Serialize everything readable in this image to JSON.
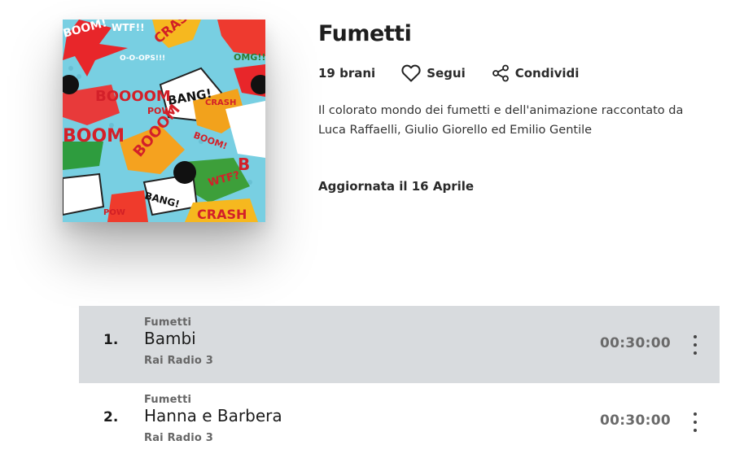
{
  "playlist": {
    "title": "Fumetti",
    "tracks_count": "19 brani",
    "follow_label": "Segui",
    "share_label": "Condividi",
    "description": "Il colorato mondo dei fumetti e dell'animazione raccontato da Luca Raffaelli, Giulio Giorello ed Emilio Gentile",
    "updated": "Aggiornata il 16 Aprile",
    "cover_words": [
      "BOOM!",
      "WTF!!",
      "CRASH",
      "O-O-OPS!!!",
      "OMG!!!",
      "BANG!",
      "BOOOOM",
      "POW",
      "CRASH",
      "BOOM!",
      "BOOOM",
      "WTF?",
      "BANG!",
      "POW",
      "CRASH"
    ]
  },
  "tracks": [
    {
      "number": "1.",
      "program": "Fumetti",
      "title": "Bambi",
      "channel": "Rai Radio 3",
      "duration": "00:30:00",
      "active": true
    },
    {
      "number": "2.",
      "program": "Fumetti",
      "title": "Hanna e Barbera",
      "channel": "Rai Radio 3",
      "duration": "00:30:00",
      "active": false
    }
  ],
  "icons": {
    "follow": "heart-icon",
    "share": "share-icon",
    "menu": "more-vertical-icon"
  }
}
